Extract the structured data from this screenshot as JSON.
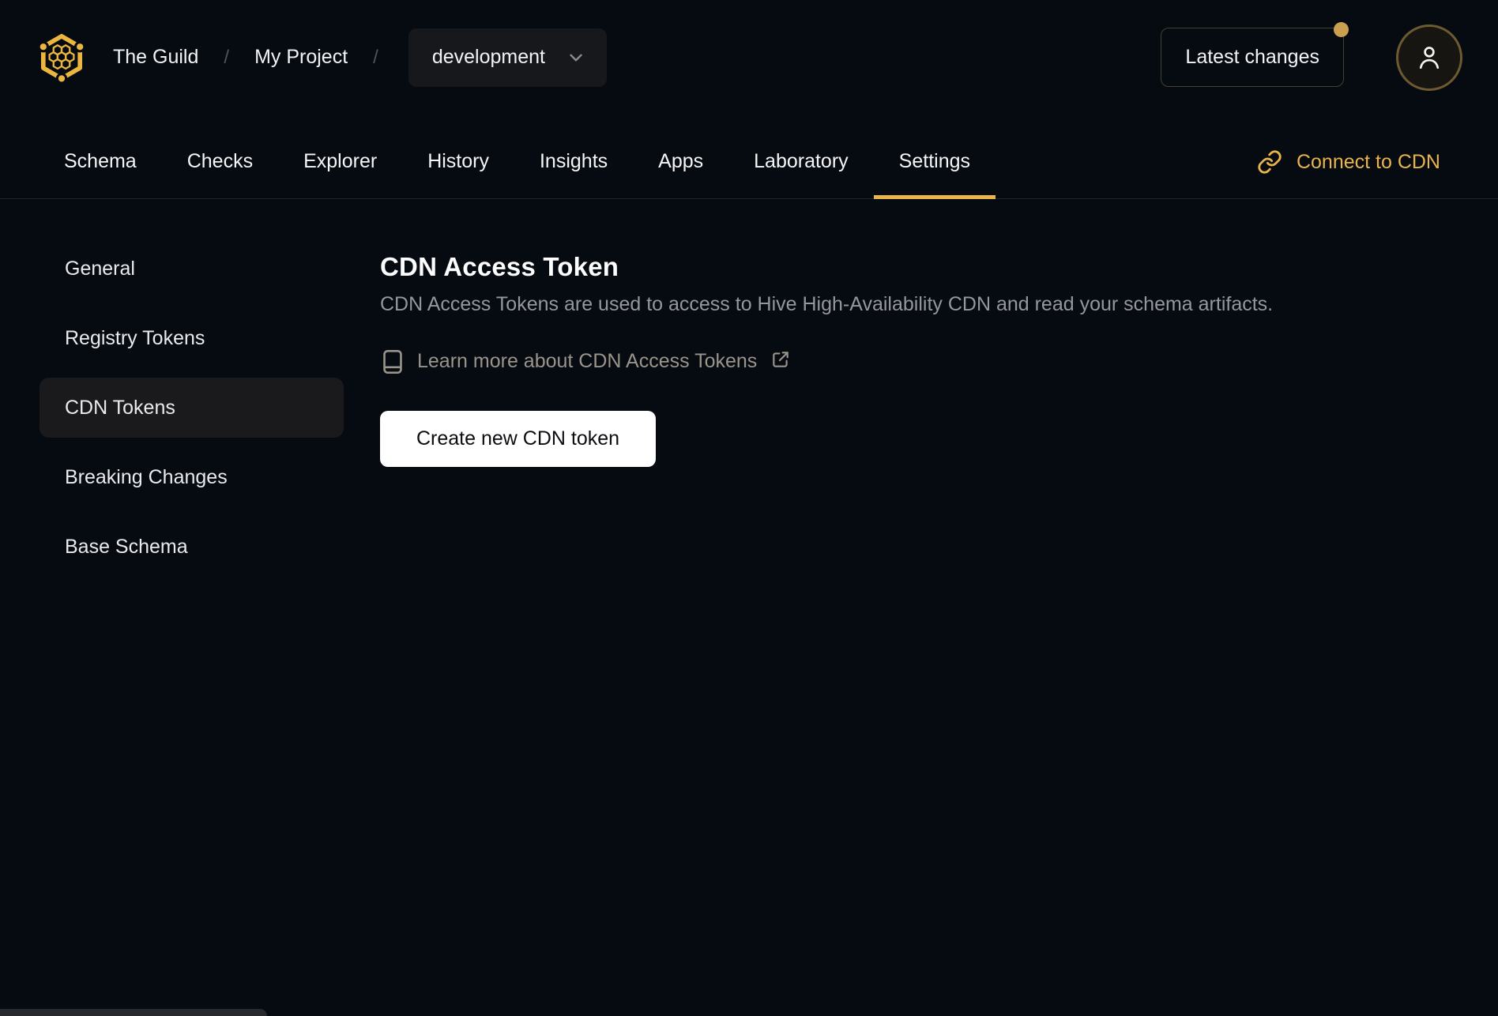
{
  "topbar": {
    "org": "The Guild",
    "separator": "/",
    "project": "My Project",
    "environment": "development",
    "latest_changes_label": "Latest changes"
  },
  "tabs": {
    "items": [
      {
        "label": "Schema",
        "active": false
      },
      {
        "label": "Checks",
        "active": false
      },
      {
        "label": "Explorer",
        "active": false
      },
      {
        "label": "History",
        "active": false
      },
      {
        "label": "Insights",
        "active": false
      },
      {
        "label": "Apps",
        "active": false
      },
      {
        "label": "Laboratory",
        "active": false
      },
      {
        "label": "Settings",
        "active": true
      }
    ],
    "connect_cdn_label": "Connect to CDN"
  },
  "sidebar": {
    "items": [
      {
        "label": "General",
        "active": false
      },
      {
        "label": "Registry Tokens",
        "active": false
      },
      {
        "label": "CDN Tokens",
        "active": true
      },
      {
        "label": "Breaking Changes",
        "active": false
      },
      {
        "label": "Base Schema",
        "active": false
      }
    ]
  },
  "main": {
    "title": "CDN Access Token",
    "description": "CDN Access Tokens are used to access to Hive High-Availability CDN and read your schema artifacts.",
    "learn_more_label": "Learn more about CDN Access Tokens",
    "create_button_label": "Create new CDN token"
  },
  "icons": {
    "logo": "hive-honeycomb-hexagon",
    "chevron": "chevron-down",
    "user": "person-outline",
    "link": "chain-link",
    "book": "book",
    "external": "external-link-arrow"
  },
  "colors": {
    "bg": "#060a11",
    "accent": "#e9b44a",
    "logo-gold": "#ecb53f",
    "notification-dot": "#c9a050",
    "muted-text": "#95979c",
    "link-muted": "#9a948b",
    "surface": "#17181c",
    "active-item-bg": "#1a1a1c",
    "border": "#282521",
    "button-bg": "#ffffff",
    "button-text": "#0c0d11"
  }
}
